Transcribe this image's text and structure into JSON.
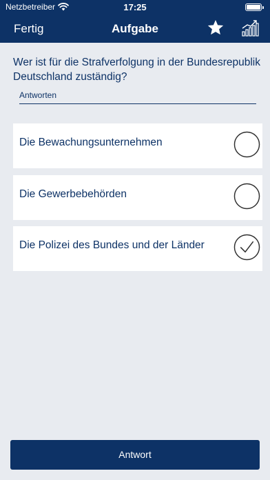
{
  "status_bar": {
    "carrier": "Netzbetreiber",
    "time": "17:25",
    "wifi_icon": "wifi-icon",
    "battery_icon": "battery-icon"
  },
  "nav": {
    "done_label": "Fertig",
    "title": "Aufgabe",
    "favorite_icon": "star-icon",
    "statistics_icon": "bar-chart-icon"
  },
  "question": {
    "text": "Wer ist für die Strafverfolgung in der Bundesrepublik Deutschland zuständig?",
    "answers_label": "Antworten"
  },
  "options": [
    {
      "label": "Die Bewachungsunternehmen",
      "selected": false
    },
    {
      "label": "Die Gewerbebehörden",
      "selected": false
    },
    {
      "label": "Die Polizei des Bundes und der Länder",
      "selected": true
    }
  ],
  "submit": {
    "label": "Antwort"
  },
  "colors": {
    "primary": "#0d3266",
    "background": "#e8ebf0",
    "card": "#ffffff"
  }
}
